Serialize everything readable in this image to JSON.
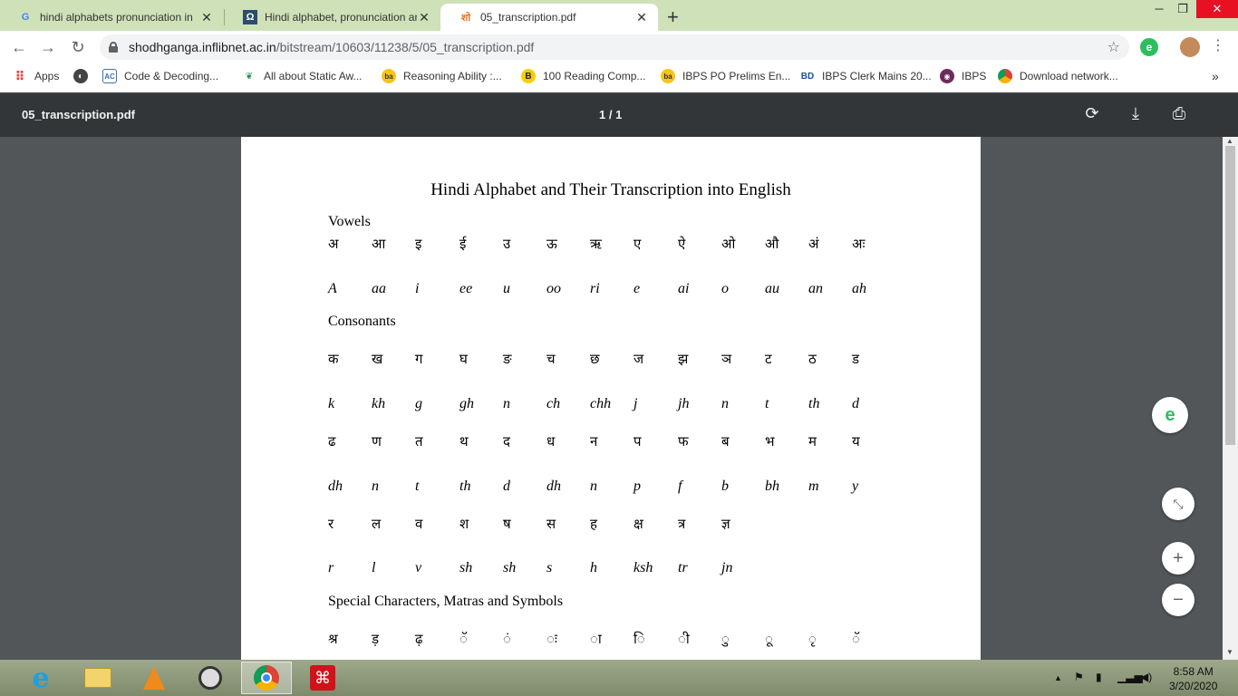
{
  "browser": {
    "tabs": [
      {
        "title": "hindi alphabets pronunciation in",
        "icon": "google-icon"
      },
      {
        "title": "Hindi alphabet, pronunciation an",
        "icon": "omniglot-icon"
      },
      {
        "title": "05_transcription.pdf",
        "icon": "shodhganga-icon",
        "active": true
      }
    ],
    "url_host": "shodhganga.inflibnet.ac.in",
    "url_path": "/bitstream/10603/11238/5/05_transcription.pdf",
    "bookmarks": [
      {
        "label": "Apps"
      },
      {
        "label": "Code & Decoding..."
      },
      {
        "label": "All about Static Aw..."
      },
      {
        "label": "Reasoning Ability :..."
      },
      {
        "label": "100 Reading Comp..."
      },
      {
        "label": "IBPS PO Prelims En..."
      },
      {
        "label": "IBPS Clerk Mains 20..."
      },
      {
        "label": "IBPS"
      },
      {
        "label": "Download network..."
      }
    ]
  },
  "pdf": {
    "filename": "05_transcription.pdf",
    "page_indicator": "1 / 1"
  },
  "document": {
    "title": "Hindi Alphabet and Their Transcription into English",
    "vowels_heading": "Vowels",
    "consonants_heading": "Consonants",
    "special_heading": "Special Characters, Matras and Symbols",
    "vowels_hindi": [
      "अ",
      "आ",
      "इ",
      "ई",
      "उ",
      "ऊ",
      "ऋ",
      "ए",
      "ऐ",
      "ओ",
      "औ",
      "अं",
      "अः"
    ],
    "vowels_roman": [
      "A",
      "aa",
      "i",
      "ee",
      "u",
      "oo",
      "ri",
      "e",
      "ai",
      "o",
      "au",
      "an",
      "ah"
    ],
    "cons1_hindi": [
      "क",
      "ख",
      "ग",
      "घ",
      "ङ",
      "च",
      "छ",
      "ज",
      "झ",
      "ञ",
      "ट",
      "ठ",
      "ड"
    ],
    "cons1_roman": [
      "k",
      "kh",
      "g",
      "gh",
      "n",
      "ch",
      "chh",
      "j",
      "jh",
      "n",
      "t",
      "th",
      "d"
    ],
    "cons2_hindi": [
      "ढ",
      "ण",
      "त",
      "थ",
      "द",
      "ध",
      "न",
      "प",
      "फ",
      "ब",
      "भ",
      "म",
      "य"
    ],
    "cons2_roman": [
      "dh",
      "n",
      "t",
      "th",
      "d",
      "dh",
      "n",
      "p",
      "f",
      "b",
      "bh",
      "m",
      "y"
    ],
    "cons3_hindi": [
      "र",
      "ल",
      "व",
      "श",
      "ष",
      "स",
      "ह",
      "क्ष",
      "त्र",
      "ज्ञ"
    ],
    "cons3_roman": [
      "r",
      "l",
      "v",
      "sh",
      "sh",
      "s",
      "h",
      "ksh",
      "tr",
      "jn"
    ],
    "special_hindi": [
      "श्र",
      "ड़",
      "ढ़",
      "ॅ",
      "ं",
      "ः",
      "ा",
      "ि",
      "ी",
      "ु",
      "ू",
      "ृ",
      "ॅ"
    ]
  },
  "taskbar": {
    "time": "8:58 AM",
    "date": "3/20/2020"
  }
}
